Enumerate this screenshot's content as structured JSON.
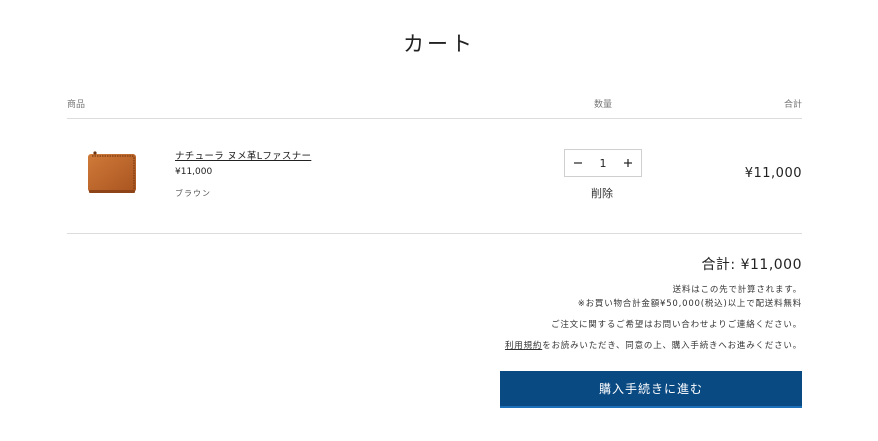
{
  "page": {
    "title": "カート"
  },
  "table_header": {
    "product": "商品",
    "quantity": "数量",
    "total": "合計"
  },
  "items": [
    {
      "name": "ナチューラ ヌメ革Lファスナー",
      "price": "¥11,000",
      "variant": "ブラウン",
      "quantity": "1",
      "remove_label": "削除",
      "line_total": "¥11,000",
      "image_color": "#c26a2c",
      "image_icon": "leather-wallet"
    }
  ],
  "summary": {
    "subtotal": "合計: ¥11,000",
    "shipping_note": "送料はこの先で計算されます。",
    "free_shipping_note": "※お買い物合計金額¥50,000(税込)以上で配送料無料",
    "request_note": "ご注文に関するご希望はお問い合わせよりご連絡ください。",
    "terms_link": "利用規約",
    "terms_rest": "をお読みいただき、同意の上、購入手続きへお進みください。"
  },
  "checkout_button": {
    "label": "購入手続きに進む",
    "color": "#0a4a83"
  },
  "icons": {
    "decrement": "minus-icon",
    "increment": "plus-icon"
  }
}
